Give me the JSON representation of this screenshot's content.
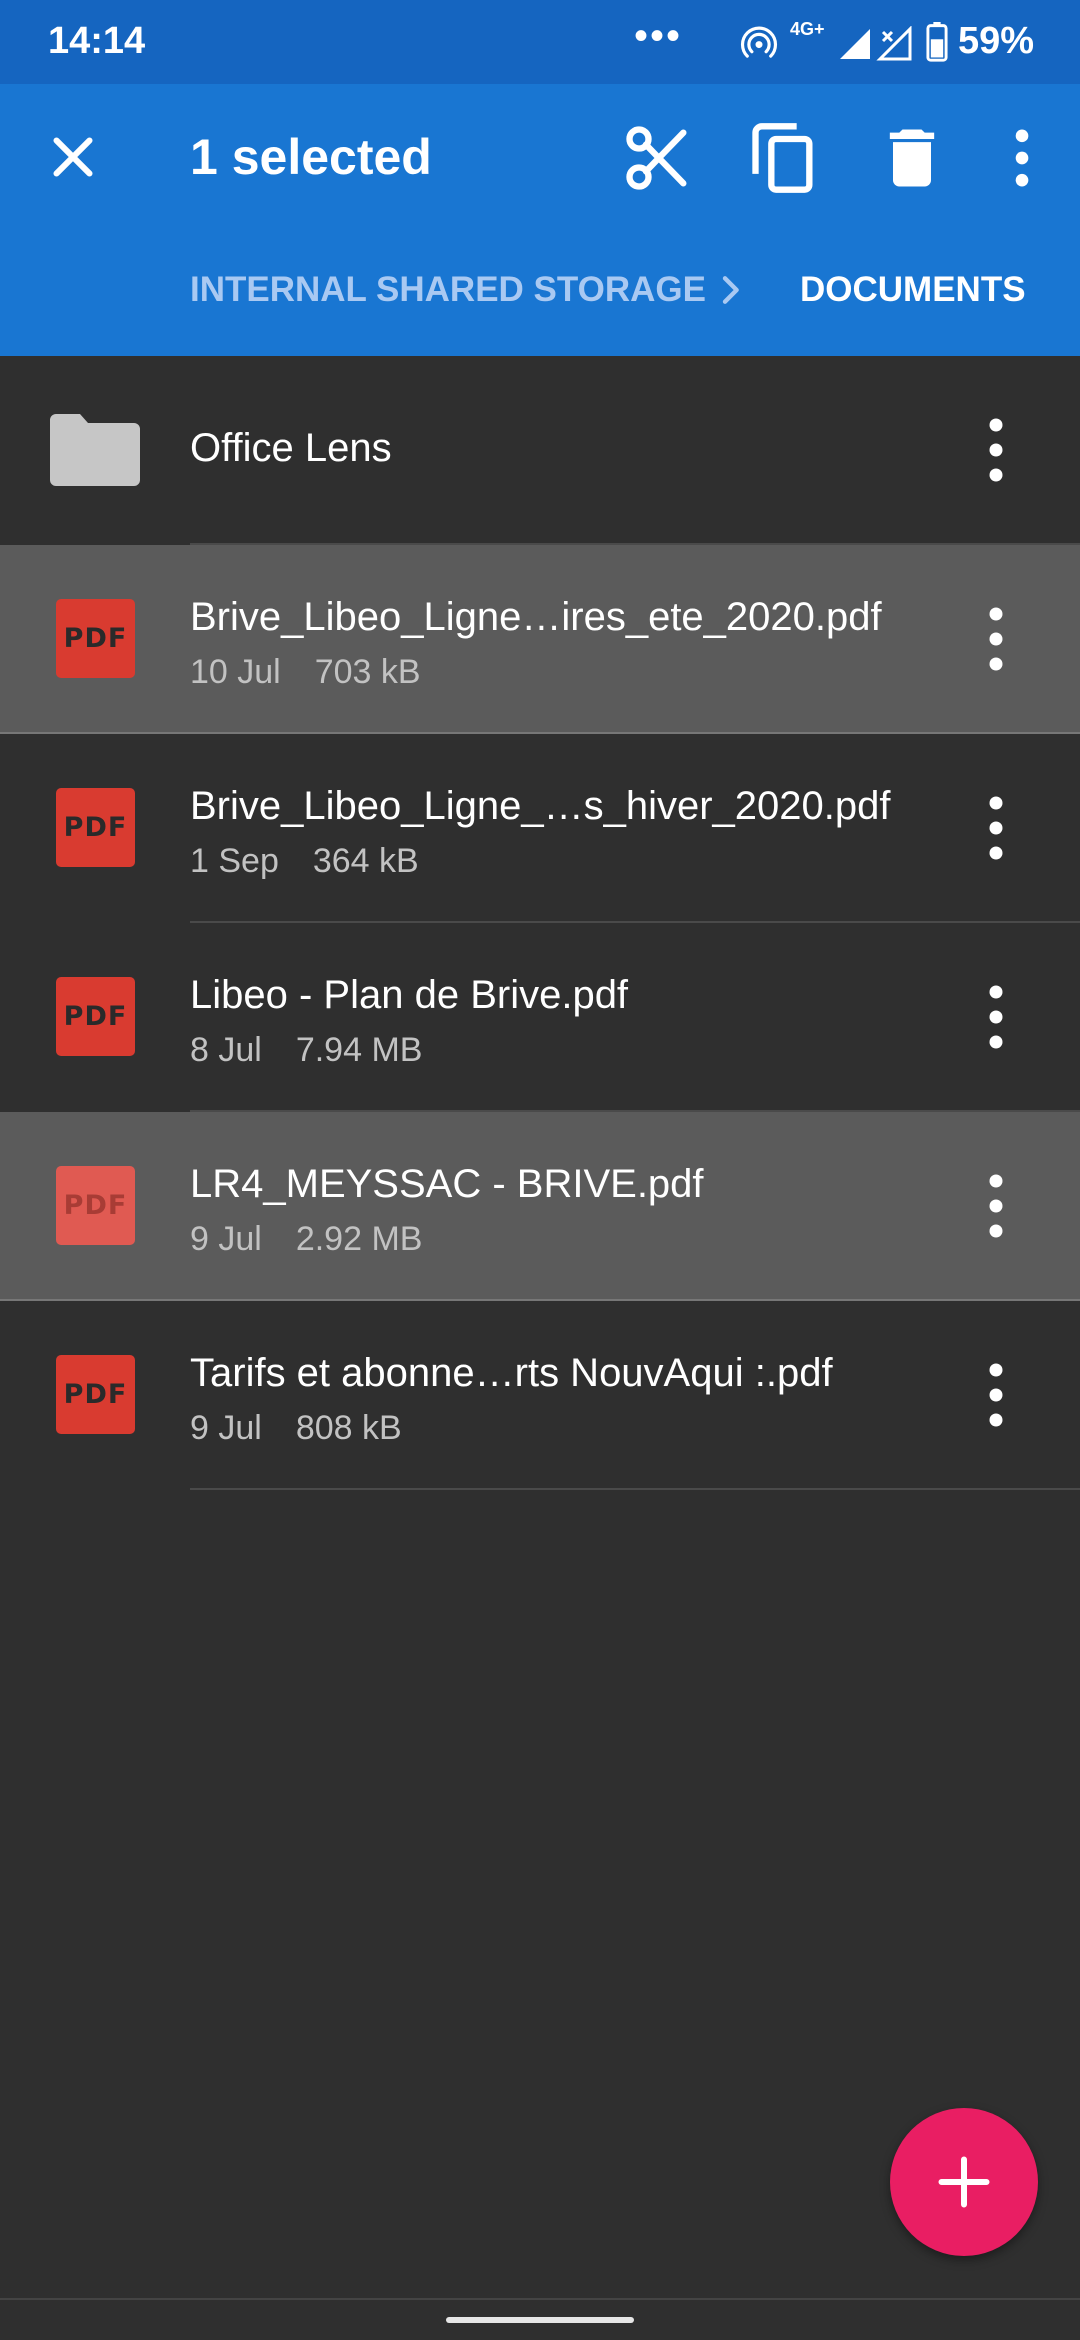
{
  "status_bar": {
    "time": "14:14",
    "dots": "•••",
    "network": "4G+",
    "battery": "59%"
  },
  "app_bar": {
    "title": "1 selected",
    "close_icon": "close-icon",
    "actions": [
      "cut-icon",
      "copy-icon",
      "delete-icon",
      "more-vert-icon"
    ],
    "breadcrumb": [
      "INTERNAL SHARED STORAGE",
      "DOCUMENTS"
    ]
  },
  "files": [
    {
      "name": "Office Lens",
      "type": "folder"
    },
    {
      "name": "Brive_Libeo_Ligne…ires_ete_2020.pdf",
      "date": "10 Jul",
      "size": "703 kB",
      "type": "pdf",
      "selected": true
    },
    {
      "name": "Brive_Libeo_Ligne_…s_hiver_2020.pdf",
      "date": "1 Sep",
      "size": "364 kB",
      "type": "pdf"
    },
    {
      "name": "Libeo - Plan de Brive.pdf",
      "date": "8 Jul",
      "size": "7.94 MB",
      "type": "pdf"
    },
    {
      "name": "LR4_MEYSSAC - BRIVE.pdf",
      "date": "9 Jul",
      "size": "2.92 MB",
      "type": "pdf",
      "selected": true
    },
    {
      "name": "Tarifs et abonne…rts NouvAqui :.pdf",
      "date": "9 Jul",
      "size": "808 kB",
      "type": "pdf"
    }
  ],
  "pdf_label": "PDF",
  "fab": {
    "icon": "plus-icon"
  },
  "colors": {
    "status_bar": "#1565c0",
    "app_bar": "#1976d2",
    "background": "#2f2f2f",
    "selected_row": "#5b5b5b",
    "pdf_red": "#d93b30",
    "fab": "#e91e63"
  }
}
